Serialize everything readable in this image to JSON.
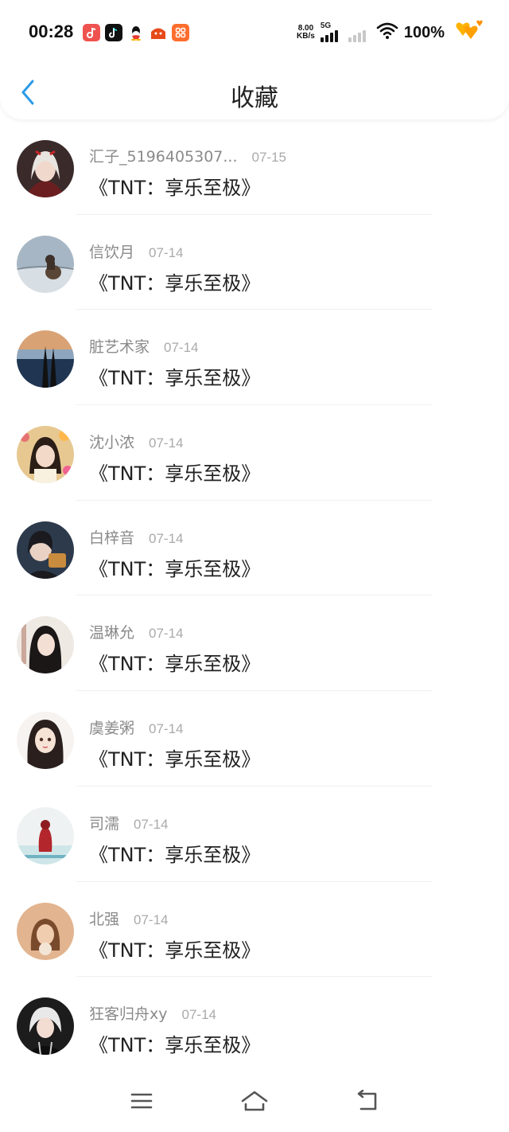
{
  "status_bar": {
    "time": "00:28",
    "net_speed_value": "8.00",
    "net_speed_unit": "KB/s",
    "network_type": "5G",
    "battery": "100%"
  },
  "header": {
    "title": "收藏",
    "accent_color": "#2b9be8"
  },
  "favorites": [
    {
      "name": "汇子_5196405307...",
      "date": "07-15",
      "title": "《TNT：享乐至极》"
    },
    {
      "name": "信饮月",
      "date": "07-14",
      "title": "《TNT：享乐至极》"
    },
    {
      "name": "脏艺术家",
      "date": "07-14",
      "title": "《TNT：享乐至极》"
    },
    {
      "name": "沈小浓",
      "date": "07-14",
      "title": "《TNT：享乐至极》"
    },
    {
      "name": "白梓音",
      "date": "07-14",
      "title": "《TNT：享乐至极》"
    },
    {
      "name": "温琳允",
      "date": "07-14",
      "title": "《TNT：享乐至极》"
    },
    {
      "name": "虞姜粥",
      "date": "07-14",
      "title": "《TNT：享乐至极》"
    },
    {
      "name": "司濡",
      "date": "07-14",
      "title": "《TNT：享乐至极》"
    },
    {
      "name": "北强",
      "date": "07-14",
      "title": "《TNT：享乐至极》"
    },
    {
      "name": "狂客归舟xy",
      "date": "07-14",
      "title": "《TNT：享乐至极》"
    }
  ],
  "nav_icons": [
    "menu-icon",
    "home-icon",
    "back-icon"
  ]
}
